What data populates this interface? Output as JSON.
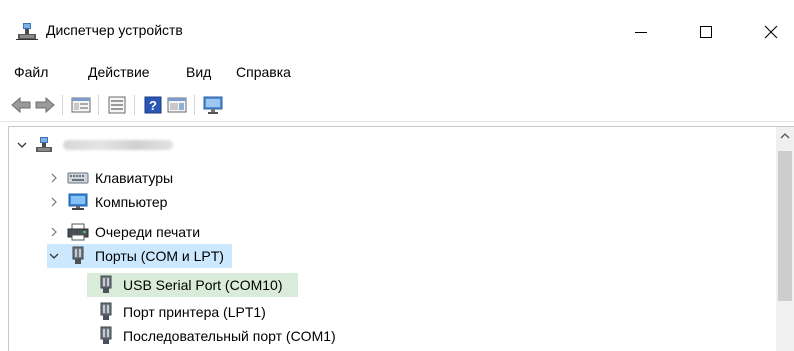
{
  "window": {
    "title": "Диспетчер устройств",
    "icon": "device-manager-icon"
  },
  "menu": {
    "items": [
      "Файл",
      "Действие",
      "Вид",
      "Справка"
    ]
  },
  "toolbar": {
    "buttons": [
      "back-arrow-icon",
      "forward-arrow-icon",
      "show-hide-tree-icon",
      "properties-icon",
      "help-icon",
      "action-pane-icon",
      "scan-hardware-icon"
    ]
  },
  "tree": {
    "root": {
      "label": "",
      "icon": "computer-root-icon",
      "expanded": true
    },
    "nodes": [
      {
        "label": "Клавиатуры",
        "icon": "keyboard-icon",
        "expanded": false,
        "level": 1
      },
      {
        "label": "Компьютер",
        "icon": "computer-icon",
        "expanded": false,
        "level": 1
      },
      {
        "label": "Очереди печати",
        "icon": "printer-icon",
        "expanded": false,
        "level": 1
      },
      {
        "label": "Порты (COM и LPT)",
        "icon": "port-icon",
        "expanded": true,
        "level": 1,
        "selected": true
      },
      {
        "label": "USB Serial Port (COM10)",
        "icon": "port-icon",
        "level": 2,
        "highlighted": true
      },
      {
        "label": "Порт принтера (LPT1)",
        "icon": "port-icon",
        "level": 2
      },
      {
        "label": "Последовательный порт (COM1)",
        "icon": "port-icon",
        "level": 2
      }
    ]
  },
  "colors": {
    "selection": "#cce8ff",
    "highlight_green": "#d9ecd9"
  }
}
